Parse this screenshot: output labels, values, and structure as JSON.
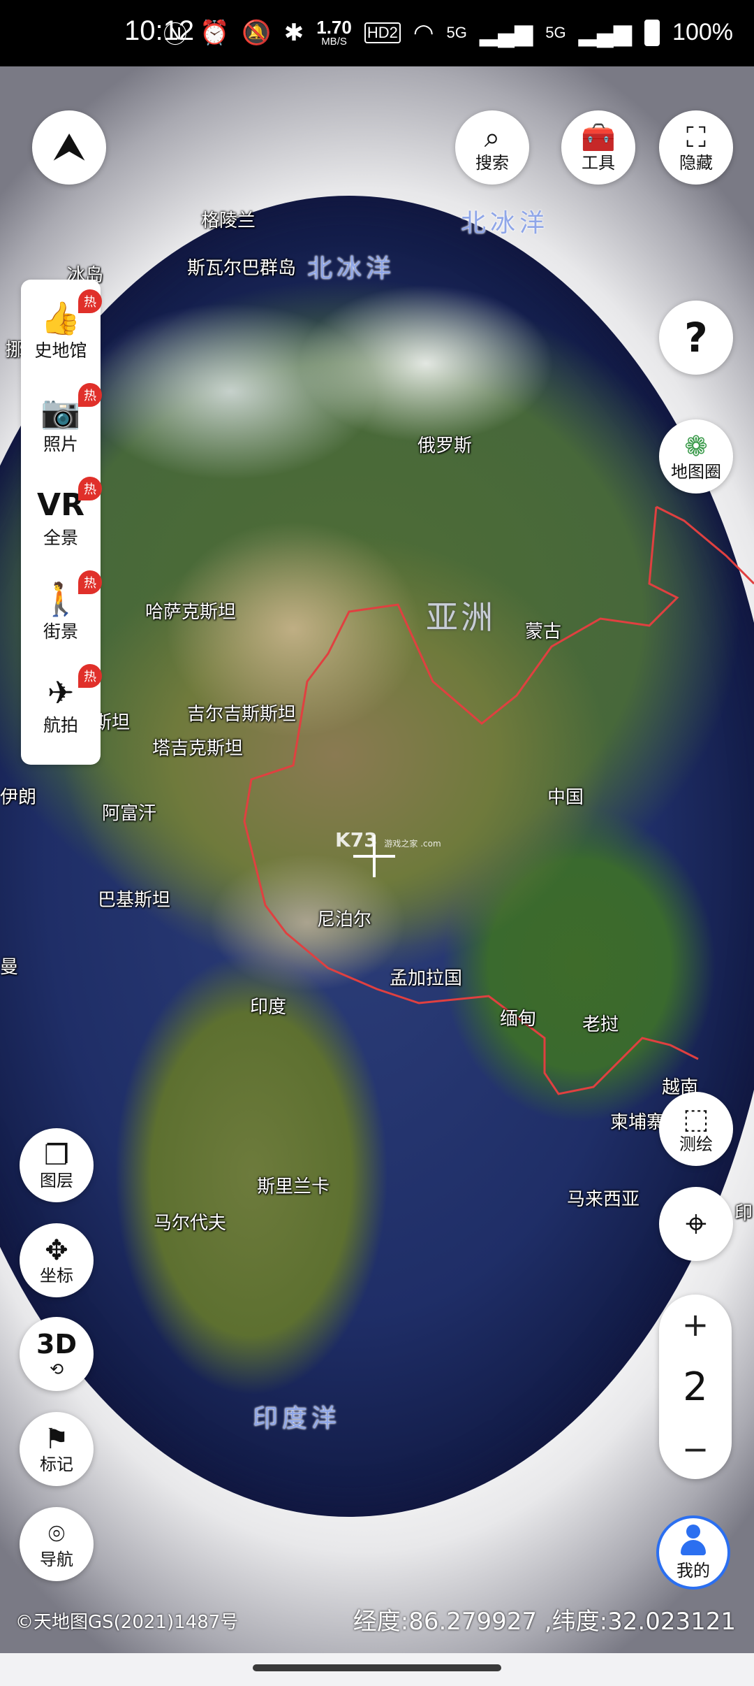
{
  "status_bar": {
    "time": "10:12",
    "speed_value": "1.70",
    "speed_unit": "MB/S",
    "hd": "HD2",
    "net1": "5G",
    "net2": "5G",
    "battery": "100%"
  },
  "toolbar": {
    "search": "搜索",
    "tools": "工具",
    "hide": "隐藏"
  },
  "left_panel": [
    {
      "label": "史地馆",
      "icon": "thumbs-up-icon",
      "badge": "热"
    },
    {
      "label": "照片",
      "icon": "camera-icon",
      "badge": "热"
    },
    {
      "label": "全景",
      "icon": "vr-icon",
      "badge": "热"
    },
    {
      "label": "街景",
      "icon": "person-icon",
      "badge": "热"
    },
    {
      "label": "航拍",
      "icon": "drone-icon",
      "badge": "热"
    }
  ],
  "right_buttons": {
    "help": "?",
    "map_circle": "地图圈",
    "survey": "测绘"
  },
  "left_buttons": {
    "layers": "图层",
    "coords": "坐标",
    "three_d": "3D",
    "mark": "标记",
    "nav": "导航"
  },
  "zoom": {
    "plus": "+",
    "level": "2",
    "minus": "−"
  },
  "me": "我的",
  "map_labels": {
    "greenland": "格陵兰",
    "arctic1": "北冰洋",
    "arctic2": "北冰洋",
    "svalbard": "斯瓦尔巴群岛",
    "iceland": "冰岛",
    "russia": "俄罗斯",
    "kazakhstan": "哈萨克斯坦",
    "asia": "亚洲",
    "mongolia": "蒙古",
    "kyrgyzstan": "吉尔吉斯斯坦",
    "tajikistan": "塔吉克斯坦",
    "afghanistan": "阿富汗",
    "china": "中国",
    "pakistan": "巴基斯坦",
    "nepal": "尼泊尔",
    "bangladesh": "孟加拉国",
    "india": "印度",
    "myanmar": "缅甸",
    "laos": "老挝",
    "vietnam": "越南",
    "cambodia": "柬埔寨",
    "srilanka": "斯里兰卡",
    "maldives": "马尔代夫",
    "malaysia": "马来西亚",
    "indian_ocean": "印度洋",
    "frag_left1": "挪",
    "frag_left2": "斯坦",
    "frag_left3": "伊朗",
    "frag_left4": "曼",
    "frag_right": "印"
  },
  "watermark": "K73",
  "watermark_small": "游戏之家 .com",
  "copyright": "©天地图GS(2021)1487号",
  "coordinates": "经度:86.279927 ,纬度:32.023121"
}
